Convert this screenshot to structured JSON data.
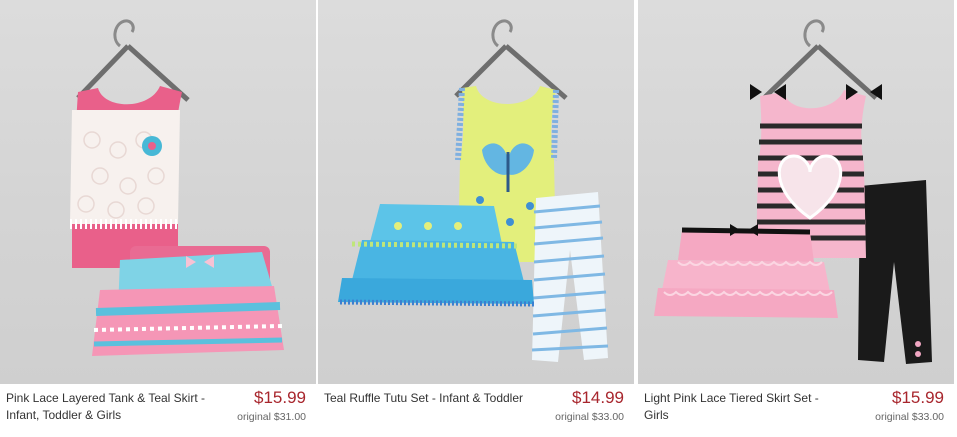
{
  "products": [
    {
      "title": "Pink Lace Layered Tank & Teal Skirt - Infant, Toddler & Girls",
      "price": "$15.99",
      "original": "original $31.00"
    },
    {
      "title": "Teal Ruffle Tutu Set - Infant & Toddler",
      "price": "$14.99",
      "original": "original $33.00"
    },
    {
      "title": "Light Pink Lace Tiered Skirt Set - Girls",
      "price": "$15.99",
      "original": "original $33.00"
    }
  ],
  "colors": {
    "price": "#a8262d",
    "photo_bg": "#d6d6d6"
  }
}
